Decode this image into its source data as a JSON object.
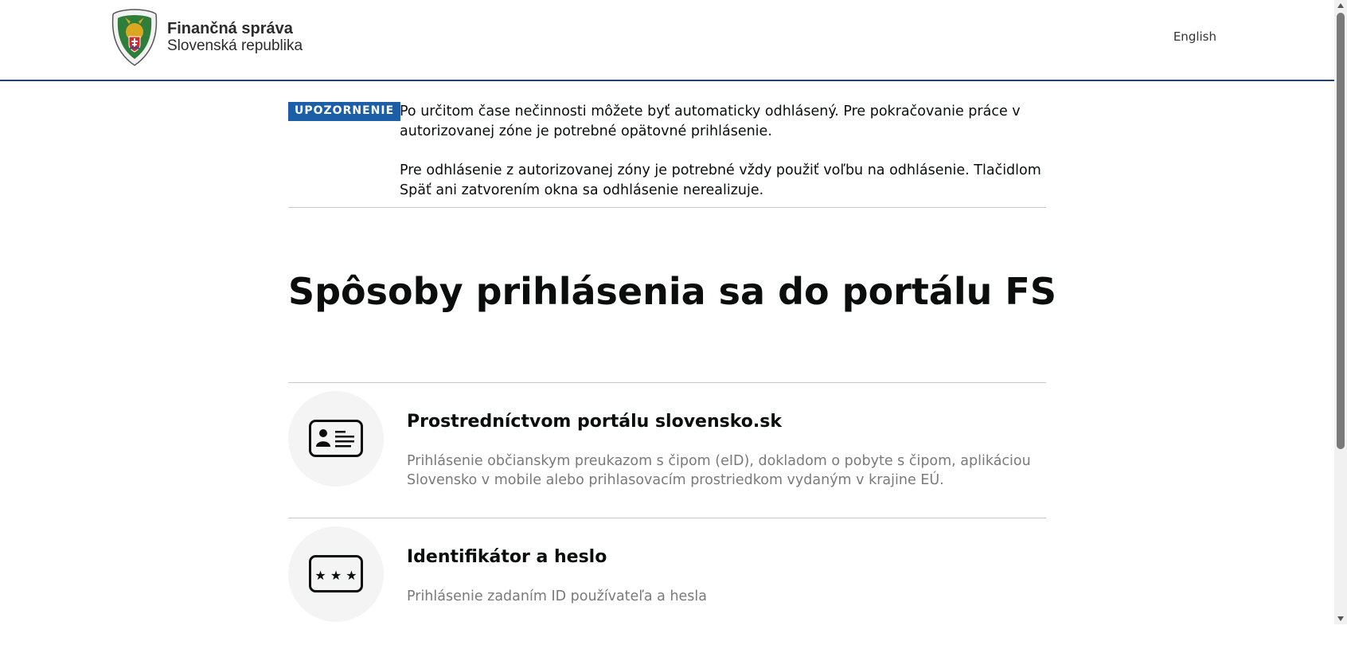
{
  "header": {
    "logo_icon": "financna-sprava-emblem",
    "logo_title": "Finančná správa",
    "logo_subtitle": "Slovenská republika",
    "language_link": "English"
  },
  "notice": {
    "badge": "UPOZORNENIE",
    "paragraph1": "Po určitom čase nečinnosti môžete byť automaticky odhlásený. Pre pokračovanie práce v autorizovanej zóne je potrebné opätovné prihlásenie.",
    "paragraph2": "Pre odhlásenie z autorizovanej zóny je potrebné vždy použiť voľbu na odhlásenie. Tlačidlom Späť ani zatvorením okna sa odhlásenie nerealizuje."
  },
  "main": {
    "title": "Spôsoby prihlásenia sa do portálu FS",
    "methods": [
      {
        "icon": "id-card-icon",
        "title": "Prostredníctvom portálu slovensko.sk",
        "description": "Prihlásenie občianskym preukazom s čipom (eID), dokladom o pobyte s čipom, aplikáciou Slovensko v mobile alebo prihlasovacím prostriedkom vydaným v krajine EÚ."
      },
      {
        "icon": "password-icon",
        "title": "Identifikátor a heslo",
        "description": "Prihlásenie zadaním ID používateľa a hesla"
      }
    ]
  },
  "colors": {
    "accent_blue": "#1d5fa7",
    "header_border": "#23416b",
    "muted_text": "#7a7a7a"
  }
}
